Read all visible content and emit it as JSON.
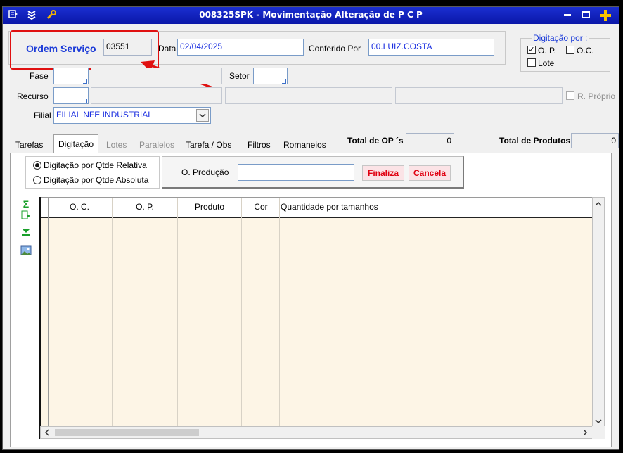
{
  "window": {
    "title": "008325SPK - Movimentação Alteração de P C P"
  },
  "header": {
    "ordem_servico_label": "Ordem Serviço",
    "ordem_servico_value": "03551",
    "data_label": "Data",
    "data_value": "02/04/2025",
    "conferido_label": "Conferido Por",
    "conferido_value": "00.LUIZ.COSTA",
    "digitacao_group_label": "Digitação por :",
    "op_label": "O. P.",
    "oc_label": "O.C.",
    "lote_label": "Lote"
  },
  "form": {
    "fase_label": "Fase",
    "setor_label": "Setor",
    "recurso_label": "Recurso",
    "r_proprio_label": "R. Próprio",
    "filial_label": "Filial",
    "filial_value": "FILIAL NFE INDUSTRIAL"
  },
  "tabs": {
    "tarefas": "Tarefas",
    "digitacao": "Digitação",
    "lotes": "Lotes",
    "paralelos": "Paralelos",
    "tarefa_obs": "Tarefa / Obs",
    "filtros": "Filtros",
    "romaneios": "Romaneios"
  },
  "totals": {
    "total_op_label": "Total de OP ´s",
    "total_op_value": "0",
    "total_produtos_label": "Total de Produtos",
    "total_produtos_value": "0"
  },
  "digitacao": {
    "radio_relativa": "Digitação por Qtde Relativa",
    "radio_absoluta": "Digitação por Qtde Absoluta",
    "producao_label": "O. Produção",
    "finaliza_label": "Finaliza",
    "cancela_label": "Cancela"
  },
  "grid": {
    "columns": [
      "O. C.",
      "O. P.",
      "Produto",
      "Cor",
      "Quantidade por tamanhos"
    ]
  },
  "colors": {
    "title_bar": "#0a17a8",
    "value_text": "#1a2ee0",
    "annotation": "#e01010",
    "grid_bg": "#fdf5e6"
  }
}
